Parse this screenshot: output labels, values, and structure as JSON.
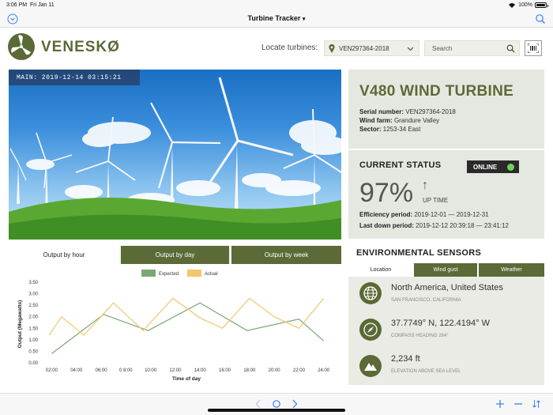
{
  "status_bar": {
    "time": "3:06 PM",
    "date": "Fri Jan 11",
    "battery": "100%",
    "battery_level": 1.0
  },
  "nav": {
    "title": "Turbine Tracker",
    "title_caret": "▾",
    "left_icon": "chevron-down-circle-icon",
    "right_icon": "search-icon"
  },
  "header": {
    "logo_text": "VENESKØ",
    "locate_label": "Locate turbines:",
    "locate_value": "VEN297364-2018",
    "search_placeholder": "Search"
  },
  "hero": {
    "timestamp": "MAIN: 2019-12-14 03:15:21"
  },
  "turbine": {
    "title": "V480 WIND TURBINE",
    "serial_label": "Serial number:",
    "serial_value": "VEN297364-2018",
    "farm_label": "Wind farm:",
    "farm_value": "Grandure Valley",
    "sector_label": "Sector:",
    "sector_value": "1253-34 East"
  },
  "status": {
    "title": "CURRENT STATUS",
    "badge": "ONLINE",
    "online_color": "#6ed15a",
    "uptime": "97%",
    "uptime_arrow": "↑",
    "uptime_label": "UP TIME",
    "efficiency_label": "Efficiency period:",
    "efficiency_value": "2019-12-01 — 2019-12-31",
    "down_label": "Last down period:",
    "down_value": "2019-12-12 20:39:18 — 23:41:12"
  },
  "chart_tabs": [
    "Output by hour",
    "Output by day",
    "Output by week"
  ],
  "chart_data": {
    "type": "line",
    "xlabel": "Time of day",
    "ylabel": "Output (Megawatts)",
    "categories": [
      "02:00",
      "04:00",
      "06:00",
      "0 8:00",
      "10:00",
      "12:00",
      "14:00",
      "16:00",
      "18:00",
      "20:00",
      "22:00",
      "24:00"
    ],
    "yticks": [
      "0.00",
      "0.50",
      "1.00",
      "1.50",
      "2.00",
      "2.50",
      "3.00",
      "3.50"
    ],
    "ylim": [
      0,
      3.5
    ],
    "x": [
      1.0,
      2.0,
      3.0,
      4.0,
      5.0,
      6.0,
      7.0,
      8.0,
      9.0,
      10.0,
      11.0,
      12.0
    ],
    "legend_position": "top",
    "series": [
      {
        "name": "Expected",
        "color": "#7aa874",
        "x": [
          1.0,
          3.1,
          4.9,
          7.0,
          8.9,
          11.0,
          12.0
        ],
        "values": [
          0.4,
          2.1,
          1.4,
          2.6,
          1.4,
          1.9,
          0.95
        ]
      },
      {
        "name": "Actual",
        "color": "#f2c66b",
        "x": [
          0.9,
          1.4,
          2.3,
          3.5,
          4.7,
          5.9,
          7.0,
          7.9,
          9.0,
          10.0,
          11.0,
          12.0
        ],
        "values": [
          1.2,
          2.0,
          1.2,
          2.6,
          1.4,
          2.8,
          1.95,
          1.5,
          2.8,
          2.0,
          1.5,
          2.8
        ]
      }
    ]
  },
  "env": {
    "title": "ENVIRONMENTAL SENSORS",
    "tabs": [
      "Location",
      "Wind gust",
      "Weather"
    ],
    "sensors": [
      {
        "icon": "globe-icon",
        "main": "North America, United States",
        "sub": "SAN FRANCISCO, CALIFORNIA"
      },
      {
        "icon": "compass-icon",
        "main": "37.7749° N, 122.4194° W",
        "sub": "COMPASS HEADING 264°"
      },
      {
        "icon": "mountain-icon",
        "main": "2,234 ft",
        "sub": "ELEVATION ABOVE SEA LEVEL"
      }
    ]
  },
  "toolbar": {
    "back_icon": "chevron-left-icon",
    "home_icon": "circle-icon",
    "forward_icon": "chevron-right-icon",
    "add_icon": "plus-icon",
    "remove_icon": "minus-icon",
    "sort_icon": "sort-icon"
  },
  "colors": {
    "brand": "#5b6a36",
    "panel": "#e5e8e0",
    "accent": "#3b82f6"
  }
}
